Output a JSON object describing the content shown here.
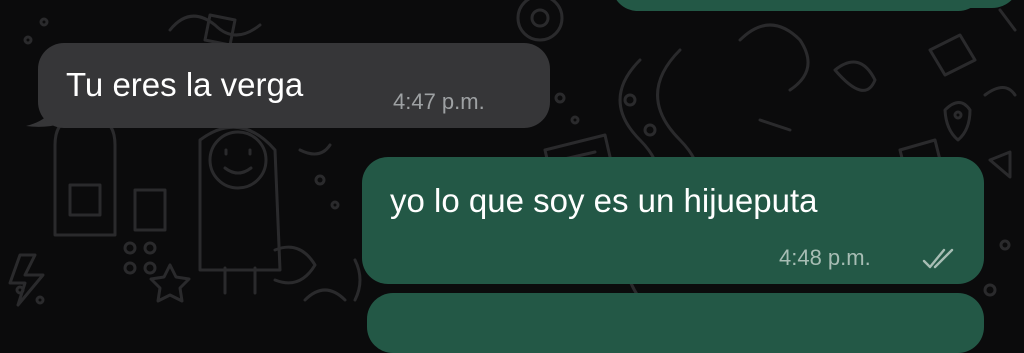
{
  "chat": {
    "messages": [
      {
        "direction": "incoming",
        "text": "Tu eres la verga",
        "time": "4:47 p.m."
      },
      {
        "direction": "outgoing",
        "text": "yo lo que soy es un hijueputa",
        "time": "4:48 p.m.",
        "status": "delivered-double-check-icon"
      }
    ]
  },
  "colors": {
    "background": "#0b0b0c",
    "incoming_bubble": "#363638",
    "outgoing_bubble": "#235846",
    "wallpaper_doodle": "#2a2a2c"
  }
}
